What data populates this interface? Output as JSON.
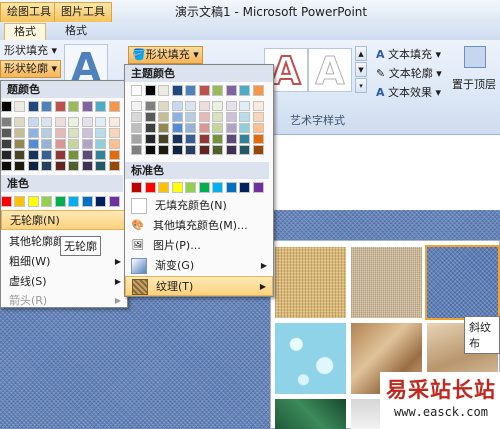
{
  "titlebar": {
    "ctx_tabs": [
      "绘图工具",
      "图片工具"
    ],
    "title": "演示文稿1 - Microsoft PowerPoint"
  },
  "tabs": [
    "格式",
    "格式"
  ],
  "ribbon": {
    "left_buttons": [
      "形状填充",
      "形状轮廓"
    ],
    "shape_fill_button": "形状填充",
    "wordart_sample_glyph": "A",
    "text_fill": "文本填充",
    "text_outline": "文本轮廓",
    "text_effects": "文本效果",
    "wordart_group_label": "艺术字样式",
    "bring_front": "置于顶层"
  },
  "outline_menu": {
    "theme_header": "题颜色",
    "std_header": "准色",
    "no_outline": "无轮廓(N)",
    "more_colors": "其他轮廓颜",
    "weight": "粗细(W)",
    "dashes": "虚线(S)",
    "arrows": "箭头(R)",
    "tooltip": "无轮廓"
  },
  "fill_menu": {
    "theme_header": "主题颜色",
    "std_header": "标准色",
    "items": [
      {
        "label": "无填充颜色(N)",
        "icon": "blank-icon"
      },
      {
        "label": "其他填充颜色(M)...",
        "icon": "color-palette-icon"
      },
      {
        "label": "图片(P)...",
        "icon": "picture-icon"
      },
      {
        "label": "渐变(G)",
        "icon": "gradient-icon",
        "submenu": true
      },
      {
        "label": "纹理(T)",
        "icon": "texture-icon",
        "submenu": true,
        "hover": true
      }
    ]
  },
  "gallery_tooltip": "斜纹布",
  "watermark": {
    "name": "易采站长站",
    "url": "www.easck.com"
  },
  "colors": {
    "theme_top": [
      "#ffffff",
      "#000000",
      "#eeece1",
      "#1f497d",
      "#4f81bd",
      "#c0504d",
      "#9bbb59",
      "#8064a2",
      "#4bacc6",
      "#f79646"
    ],
    "theme_shades": [
      [
        "#f2f2f2",
        "#7f7f7f",
        "#ddd9c3",
        "#c6d9f0",
        "#dbe5f1",
        "#f2dcdb",
        "#ebf1dd",
        "#e5e0ec",
        "#dbeef3",
        "#fdeada"
      ],
      [
        "#d8d8d8",
        "#595959",
        "#c4bd97",
        "#8db3e2",
        "#b8cce4",
        "#e5b9b7",
        "#d7e3bc",
        "#ccc1d9",
        "#b7dde8",
        "#fbd5b5"
      ],
      [
        "#bfbfbf",
        "#3f3f3f",
        "#938953",
        "#548dd4",
        "#95b3d7",
        "#d99694",
        "#c3d69b",
        "#b2a2c7",
        "#92cddc",
        "#fac08f"
      ],
      [
        "#a5a5a5",
        "#262626",
        "#494429",
        "#17365d",
        "#366092",
        "#953734",
        "#76923c",
        "#5f497a",
        "#31859b",
        "#e36c09"
      ],
      [
        "#7f7f7f",
        "#0c0c0c",
        "#1d1b10",
        "#0f243e",
        "#244061",
        "#632423",
        "#4f6128",
        "#3f3151",
        "#205867",
        "#974806"
      ]
    ],
    "standard": [
      "#c00000",
      "#ff0000",
      "#ffc000",
      "#ffff00",
      "#92d050",
      "#00b050",
      "#00b0f0",
      "#0070c0",
      "#002060",
      "#7030a0"
    ]
  }
}
